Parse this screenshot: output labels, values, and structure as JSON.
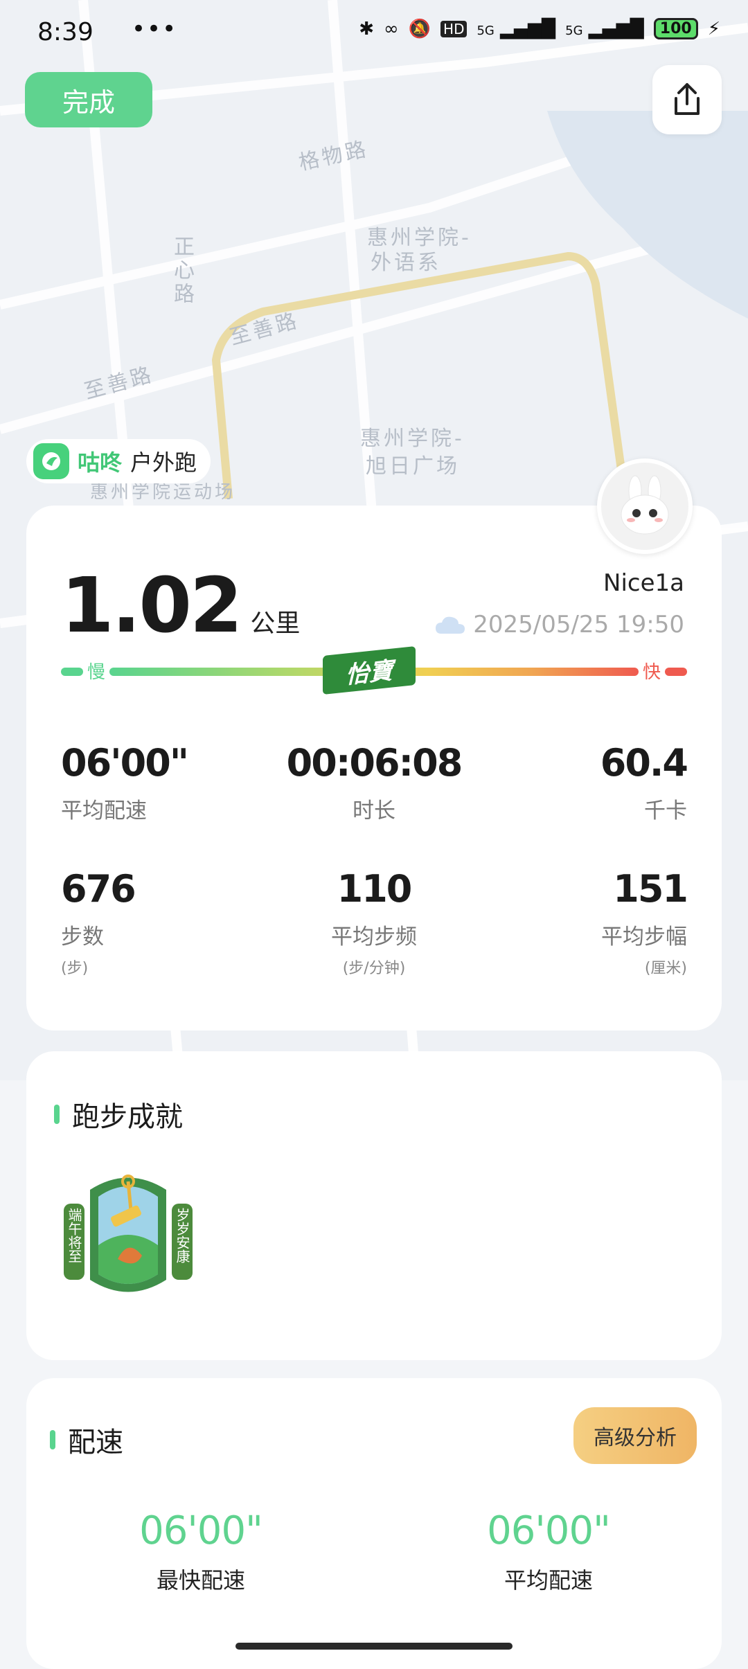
{
  "status_bar": {
    "time": "8:39",
    "dots": "•••",
    "icons": [
      "bluetooth-icon",
      "link-icon",
      "mute-icon",
      "hd-icon",
      "signal-5g-icon",
      "signal-5g-icon"
    ],
    "hd": "HD",
    "net1": "5G",
    "net2": "5G",
    "battery": "100"
  },
  "header": {
    "done_label": "完成",
    "share_icon": "share-icon"
  },
  "map": {
    "labels": [
      "格物路",
      "惠州学院-",
      "外语系",
      "至善路",
      "至善路",
      "惠州学院-",
      "旭日广场",
      "正心路",
      "惠州学院运动场"
    ]
  },
  "app": {
    "name": "咕咚",
    "mode": "户外跑"
  },
  "run": {
    "distance": "1.02",
    "distance_unit": "公里",
    "username": "Nice1a",
    "datetime": "2025/05/25 19:50",
    "slow_label": "慢",
    "fast_label": "快",
    "brand": "怡寶",
    "stats": {
      "avg_pace": {
        "value": "06'00\"",
        "label": "平均配速"
      },
      "duration": {
        "value": "00:06:08",
        "label": "时长"
      },
      "calories": {
        "value": "60.4",
        "label": "千卡"
      },
      "steps": {
        "value": "676",
        "label": "步数",
        "unit": "(步)"
      },
      "cadence": {
        "value": "110",
        "label": "平均步频",
        "unit": "(步/分钟)"
      },
      "stride": {
        "value": "151",
        "label": "平均步幅",
        "unit": "(厘米)"
      }
    }
  },
  "achievements": {
    "title": "跑步成就",
    "badge": {
      "left_text": "端午将至",
      "right_text": "岁岁安康"
    }
  },
  "pace": {
    "title": "配速",
    "advanced_label": "高级分析",
    "fastest": {
      "value": "06'00\"",
      "label": "最快配速"
    },
    "average": {
      "value": "06'00\"",
      "label": "平均配速"
    }
  },
  "colors": {
    "accent_green": "#5fd38f",
    "fast_red": "#ef5a4f",
    "gold_button": "#f5cf82"
  }
}
